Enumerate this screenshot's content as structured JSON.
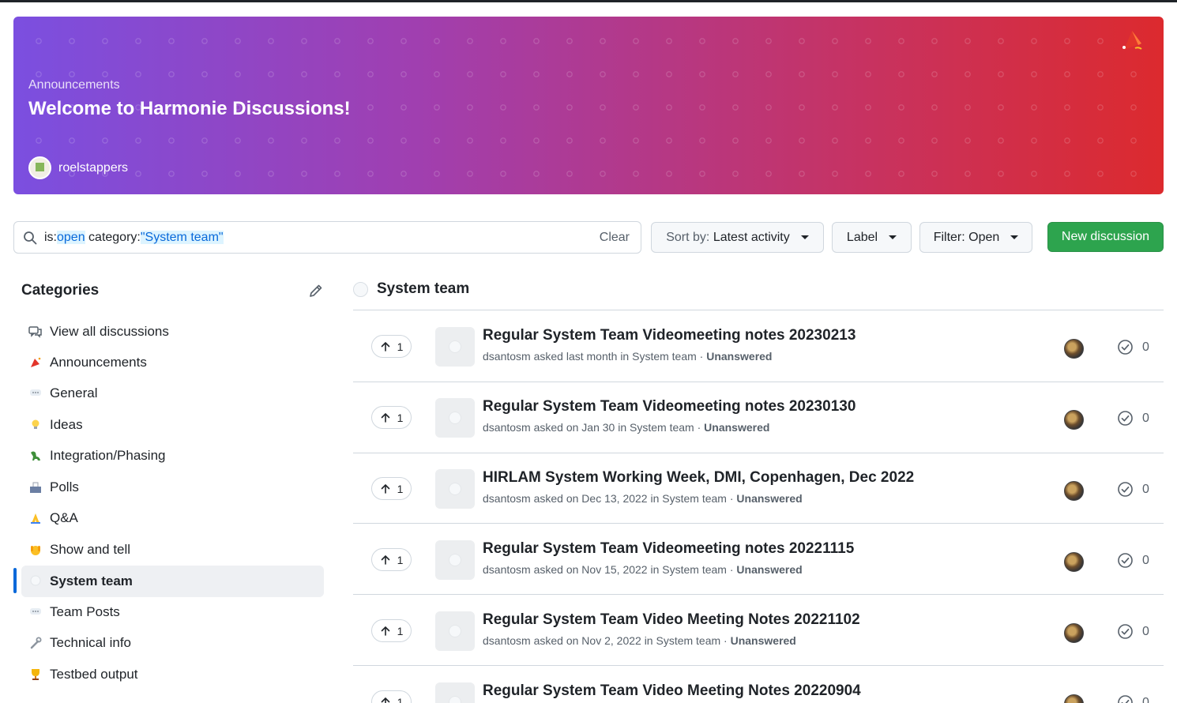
{
  "banner": {
    "category": "Announcements",
    "title": "Welcome to Harmonie Discussions!",
    "author": "roelstappers",
    "icon": "party-popper-icon"
  },
  "search": {
    "prefix": "is:",
    "open": "open",
    "middle": " category:",
    "category": "\"System team\"",
    "clear_label": "Clear"
  },
  "toolbar": {
    "sort_prefix": "Sort by: ",
    "sort_value": "Latest activity",
    "label": "Label",
    "filter": "Filter: Open",
    "new_discussion": "New discussion"
  },
  "sidebar": {
    "title": "Categories",
    "items": [
      {
        "label": "View all discussions",
        "icon": "comments-icon"
      },
      {
        "label": "Announcements",
        "icon": "party-popper-icon"
      },
      {
        "label": "General",
        "icon": "speech-balloon-icon"
      },
      {
        "label": "Ideas",
        "icon": "lightbulb-icon"
      },
      {
        "label": "Integration/Phasing",
        "icon": "dinosaur-icon"
      },
      {
        "label": "Polls",
        "icon": "ballot-box-icon"
      },
      {
        "label": "Q&A",
        "icon": "pray-icon"
      },
      {
        "label": "Show and tell",
        "icon": "raised-hands-icon"
      },
      {
        "label": "System team",
        "icon": "thought-balloon-icon"
      },
      {
        "label": "Team Posts",
        "icon": "speech-balloon-icon"
      },
      {
        "label": "Technical info",
        "icon": "wrench-icon"
      },
      {
        "label": "Testbed output",
        "icon": "trophy-icon"
      }
    ],
    "active_index": 8
  },
  "main": {
    "heading": "System team",
    "discussions": [
      {
        "votes": "1",
        "title": "Regular System Team Videomeeting notes 20230213",
        "author": "dsantosm",
        "when": " asked last month in System team · ",
        "status": "Unanswered",
        "answers": "0"
      },
      {
        "votes": "1",
        "title": "Regular System Team Videomeeting notes 20230130",
        "author": "dsantosm",
        "when": " asked on Jan 30 in System team · ",
        "status": "Unanswered",
        "answers": "0"
      },
      {
        "votes": "1",
        "title": "HIRLAM System Working Week, DMI, Copenhagen, Dec 2022",
        "author": "dsantosm",
        "when": " asked on Dec 13, 2022 in System team · ",
        "status": "Unanswered",
        "answers": "0"
      },
      {
        "votes": "1",
        "title": "Regular System Team Videomeeting notes 20221115",
        "author": "dsantosm",
        "when": " asked on Nov 15, 2022 in System team · ",
        "status": "Unanswered",
        "answers": "0"
      },
      {
        "votes": "1",
        "title": "Regular System Team Video Meeting Notes 20221102",
        "author": "dsantosm",
        "when": " asked on Nov 2, 2022 in System team · ",
        "status": "Unanswered",
        "answers": "0"
      },
      {
        "votes": "1",
        "title": "Regular System Team Video Meeting Notes 20220904",
        "author": "",
        "when": "",
        "status": "",
        "answers": "0"
      }
    ]
  },
  "colors": {
    "accent_blue": "#0969da",
    "primary_green": "#2da44e",
    "banner_start": "#7b4fe0",
    "banner_end": "#dc2a2e"
  }
}
